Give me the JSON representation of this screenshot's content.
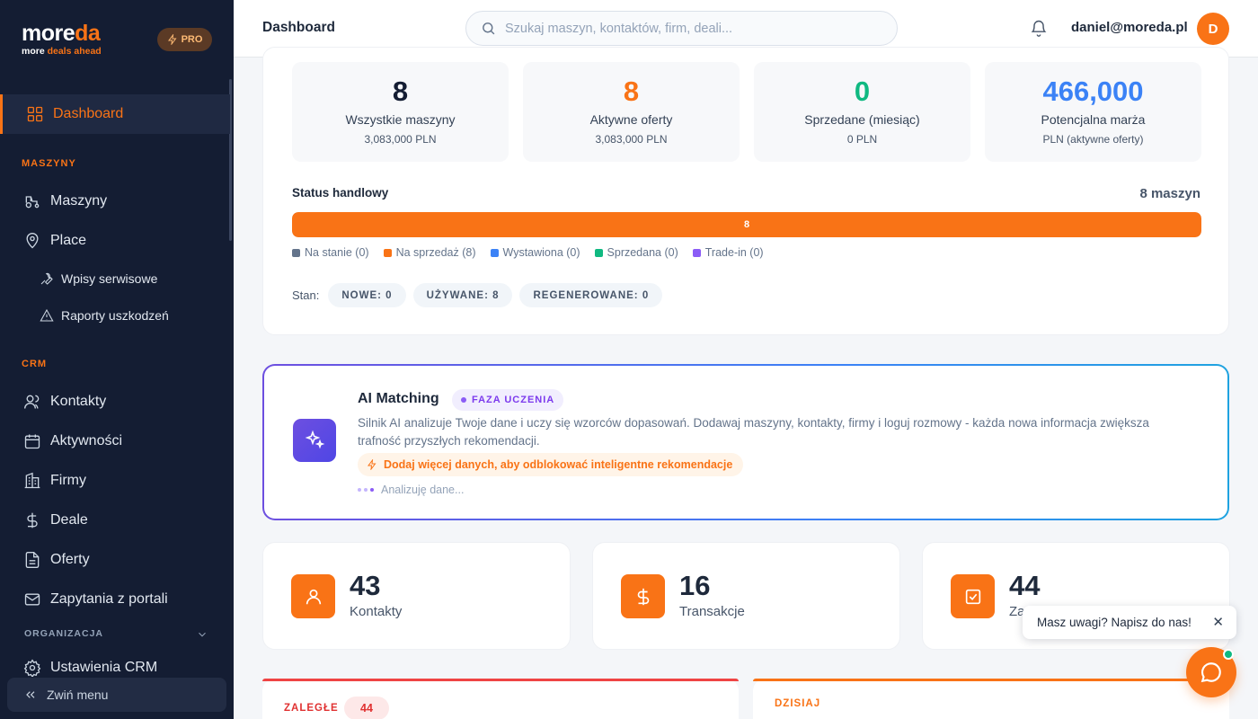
{
  "brand": {
    "logo_main": "more",
    "logo_accent": "da",
    "tagline_main": "more ",
    "tagline_accent": "deals ahead",
    "pro_label": "PRO"
  },
  "sidebar": {
    "dashboard": "Dashboard",
    "section_machines": "MASZYNY",
    "machines": "Maszyny",
    "places": "Place",
    "service_entries": "Wpisy serwisowe",
    "damage_reports": "Raporty uszkodzeń",
    "section_crm": "CRM",
    "contacts": "Kontakty",
    "activities": "Aktywności",
    "companies": "Firmy",
    "deals": "Deale",
    "offers": "Oferty",
    "portal_inquiries": "Zapytania z portali",
    "section_org": "ORGANIZACJA",
    "crm_settings": "Ustawienia CRM",
    "collapse": "Zwiń menu"
  },
  "topbar": {
    "title": "Dashboard",
    "search_placeholder": "Szukaj maszyn, kontaktów, firm, deali...",
    "user_email": "daniel@moreda.pl",
    "avatar_initial": "D"
  },
  "stats": [
    {
      "value": "8",
      "label": "Wszystkie maszyny",
      "sub": "3,083,000 PLN",
      "color": "#141d33"
    },
    {
      "value": "8",
      "label": "Aktywne oferty",
      "sub": "3,083,000 PLN",
      "color": "#f97316"
    },
    {
      "value": "0",
      "label": "Sprzedane (miesiąc)",
      "sub": "0 PLN",
      "color": "#10b981"
    },
    {
      "value": "466,000",
      "label": "Potencjalna marża",
      "sub": "PLN (aktywne oferty)",
      "color": "#3b82f6"
    }
  ],
  "status": {
    "title": "Status handlowy",
    "count": "8 maszyn",
    "bar_value": "8",
    "bar_fraction": 1.0,
    "legend": [
      {
        "label": "Na stanie (0)",
        "color": "#64748b"
      },
      {
        "label": "Na sprzedaż (8)",
        "color": "#f97316"
      },
      {
        "label": "Wystawiona (0)",
        "color": "#3b82f6"
      },
      {
        "label": "Sprzedana (0)",
        "color": "#10b981"
      },
      {
        "label": "Trade-in (0)",
        "color": "#8b5cf6"
      }
    ],
    "stan_label": "Stan:",
    "stan": [
      "NOWE: 0",
      "UŻYWANE: 8",
      "REGENEROWANE: 0"
    ]
  },
  "ai": {
    "title": "AI Matching",
    "badge": "FAZA UCZENIA",
    "description": "Silnik AI analizuje Twoje dane i uczy się wzorców dopasowań. Dodawaj maszyny, kontakty, firmy i loguj rozmowy - każda nowa informacja zwiększa trafność przyszłych rekomendacji.",
    "hint": "Dodaj więcej danych, aby odblokować inteligentne rekomendacje",
    "analyzing": "Analizuję dane..."
  },
  "kpis": [
    {
      "value": "43",
      "label": "Kontakty",
      "icon": "user-icon"
    },
    {
      "value": "16",
      "label": "Transakcje",
      "icon": "dollar-icon"
    },
    {
      "value": "44",
      "label": "Za",
      "icon": "checkbox-icon"
    }
  ],
  "bottom": {
    "overdue_label": "ZALEGŁE",
    "overdue_count": "44",
    "today_label": "DZISIAJ"
  },
  "feedback": {
    "tip": "Masz uwagi? Napisz do nas!",
    "close": "✕"
  },
  "colors": {
    "accent": "#f97316",
    "sidebar_bg": "#141d33"
  }
}
